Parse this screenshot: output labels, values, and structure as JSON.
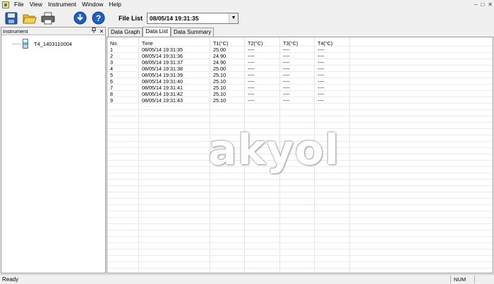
{
  "menu": {
    "items": [
      "File",
      "View",
      "Instrument",
      "Window",
      "Help"
    ],
    "window_controls": [
      "–",
      "□",
      "✕"
    ]
  },
  "toolbar": {
    "buttons": [
      "save-icon",
      "open-folder-icon",
      "print-icon",
      "download-icon",
      "help-icon"
    ],
    "file_list_label": "File List",
    "file_list_value": "08/05/14 19:31:35",
    "dropdown_arrow": "▼"
  },
  "instrument_panel": {
    "title": "Instrument",
    "pin": "ᵖ",
    "close": "✕",
    "device_label": "T4_1403110004"
  },
  "tabs": [
    {
      "label": "Data Graph",
      "active": false
    },
    {
      "label": "Data List",
      "active": true
    },
    {
      "label": "Data Summary",
      "active": false
    }
  ],
  "table": {
    "headers": [
      "No.",
      "Time",
      "T1(°C)",
      "T2(°C)",
      "T3(°C)",
      "T4(°C)"
    ],
    "rows": [
      [
        "1",
        "08/05/14 19:31:35",
        "25.00",
        "----",
        "----",
        "----"
      ],
      [
        "2",
        "08/05/14 19:31:36",
        "24.90",
        "----",
        "----",
        "----"
      ],
      [
        "3",
        "08/05/14 19:31:37",
        "24.90",
        "----",
        "----",
        "----"
      ],
      [
        "4",
        "08/05/14 19:31:38",
        "25.00",
        "----",
        "----",
        "----"
      ],
      [
        "5",
        "08/05/14 19:31:39",
        "25.10",
        "----",
        "----",
        "----"
      ],
      [
        "6",
        "08/05/14 19:31:40",
        "25.10",
        "----",
        "----",
        "----"
      ],
      [
        "7",
        "08/05/14 19:31:41",
        "25.10",
        "----",
        "----",
        "----"
      ],
      [
        "8",
        "08/05/14 19:31:42",
        "25.10",
        "----",
        "----",
        "----"
      ],
      [
        "9",
        "08/05/14 19:31:43",
        "25.10",
        "----",
        "----",
        "----"
      ]
    ]
  },
  "watermark": "akyol",
  "status": {
    "text": "Ready",
    "num": "NUM"
  }
}
